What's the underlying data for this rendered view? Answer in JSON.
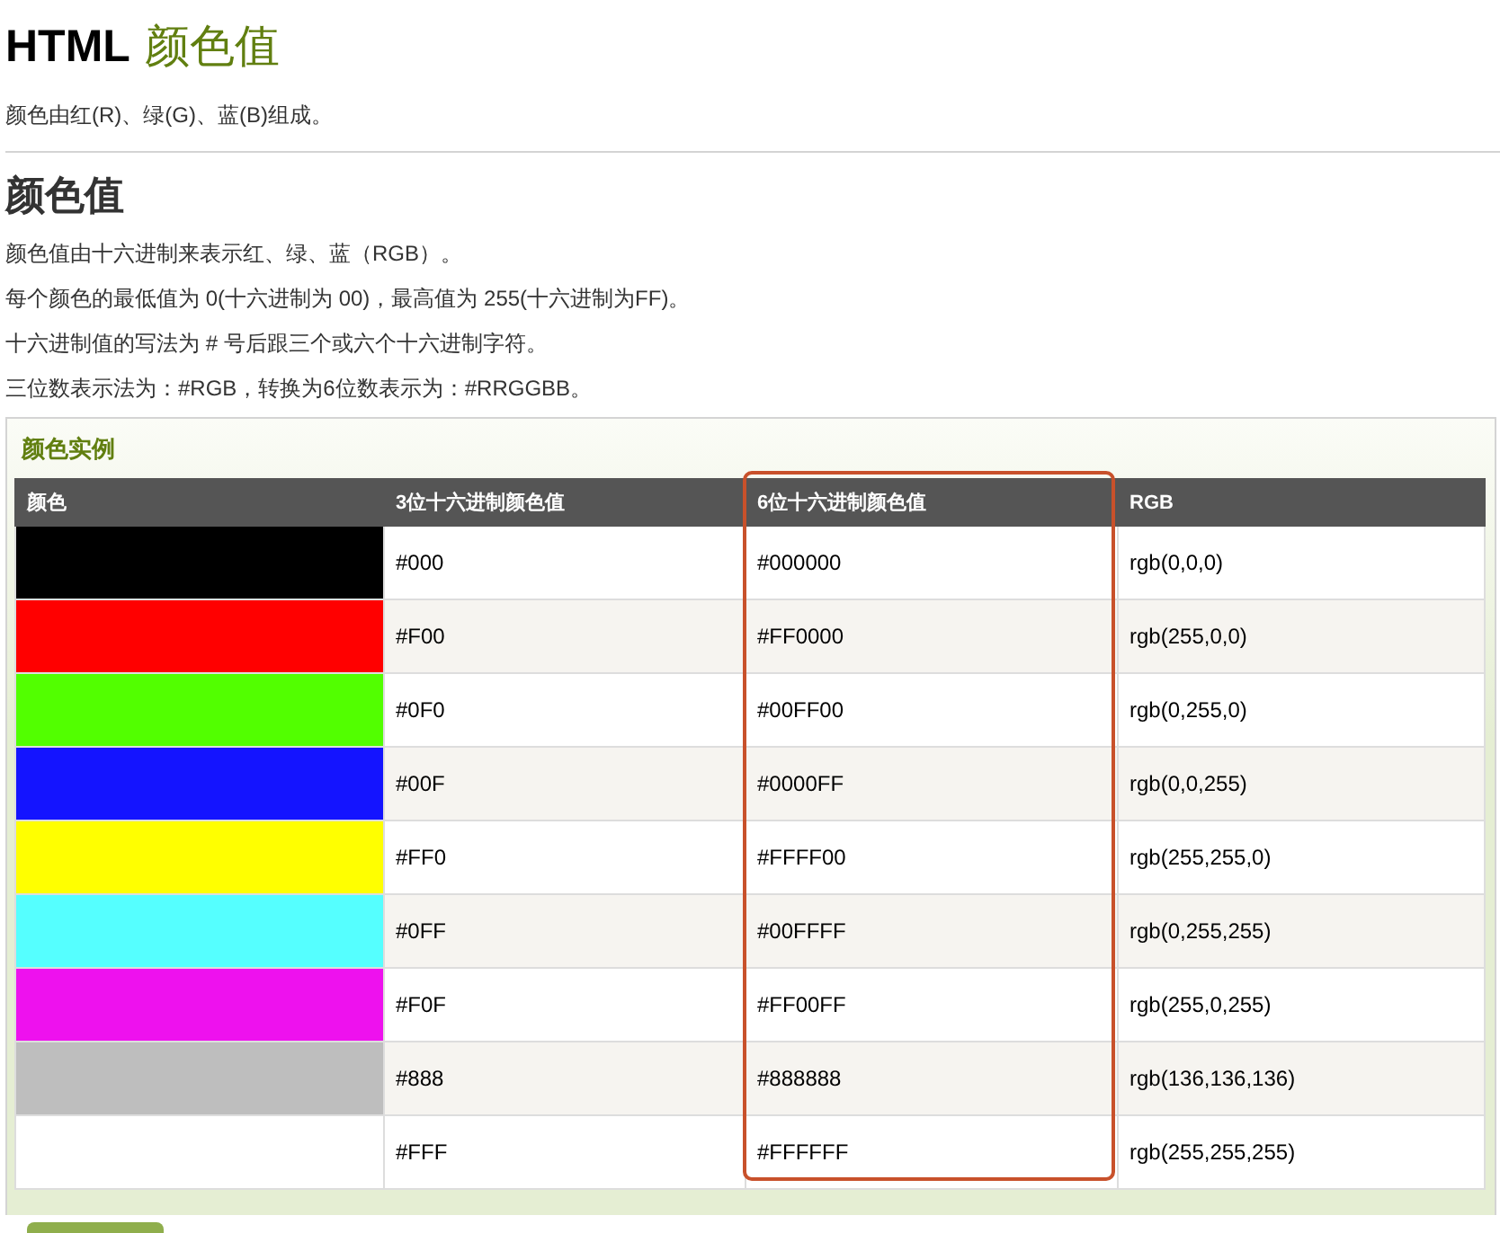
{
  "title": {
    "main": "HTML",
    "accent": "颜色值"
  },
  "intro": "颜色由红(R)、绿(G)、蓝(B)组成。",
  "section": {
    "heading": "颜色值",
    "paragraphs": [
      "颜色值由十六进制来表示红、绿、蓝（RGB）。",
      "每个颜色的最低值为 0(十六进制为 00)，最高值为 255(十六进制为FF)。",
      "十六进制值的写法为 # 号后跟三个或六个十六进制字符。",
      "三位数表示法为：#RGB，转换为6位数表示为：#RRGGBB。"
    ]
  },
  "example": {
    "title": "颜色实例",
    "columns": [
      {
        "label": "颜色",
        "highlighted": false
      },
      {
        "label": "3位十六进制颜色值",
        "highlighted": false
      },
      {
        "label": "6位十六进制颜色值",
        "highlighted": true
      },
      {
        "label": "RGB",
        "highlighted": false
      }
    ],
    "rows": [
      {
        "color": "#000000",
        "short": "#000",
        "long": "#000000",
        "rgb": "rgb(0,0,0)"
      },
      {
        "color": "#ff0000",
        "short": "#F00",
        "long": "#FF0000",
        "rgb": "rgb(255,0,0)"
      },
      {
        "color": "#52ff00",
        "short": "#0F0",
        "long": "#00FF00",
        "rgb": "rgb(0,255,0)"
      },
      {
        "color": "#1414ff",
        "short": "#00F",
        "long": "#0000FF",
        "rgb": "rgb(0,0,255)"
      },
      {
        "color": "#ffff00",
        "short": "#FF0",
        "long": "#FFFF00",
        "rgb": "rgb(255,255,0)"
      },
      {
        "color": "#55ffff",
        "short": "#0FF",
        "long": "#00FFFF",
        "rgb": "rgb(0,255,255)"
      },
      {
        "color": "#ee11ee",
        "short": "#F0F",
        "long": "#FF00FF",
        "rgb": "rgb(255,0,255)"
      },
      {
        "color": "#bebebe",
        "short": "#888",
        "long": "#888888",
        "rgb": "rgb(136,136,136)"
      },
      {
        "color": "#ffffff",
        "short": "#FFF",
        "long": "#FFFFFF",
        "rgb": "rgb(255,255,255)"
      }
    ]
  }
}
